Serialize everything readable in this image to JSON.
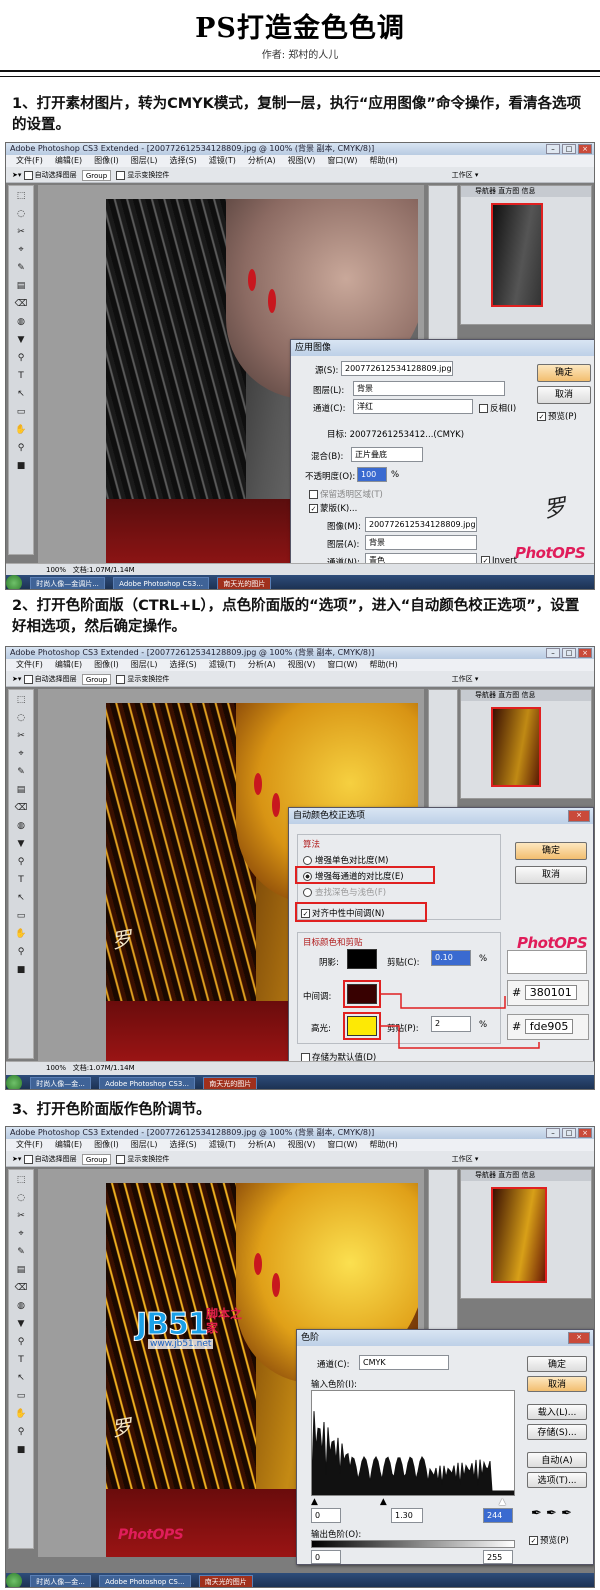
{
  "doc": {
    "title": "PS打造金色色调",
    "author": "作者: 郑村的人儿"
  },
  "steps": [
    {
      "text": "1、打开素材图片，转为CMYK模式，复制一层，执行“应用图像”命令操作，看清各选项的设置。"
    },
    {
      "text": "2、打开色阶面版（CTRL+L），点色阶面版的“选项”，进入“自动颜色校正选项”，设置好相选项，然后确定操作。"
    },
    {
      "text": "3、打开色阶面版作色阶调节。"
    }
  ],
  "app": {
    "window_title": "Adobe Photoshop CS3 Extended - [2007726125341288​09.jpg @ 100% (背景 副本, CMYK/8)]",
    "menus": [
      "文件(F)",
      "编辑(E)",
      "图像(I)",
      "图层(L)",
      "选择(S)",
      "滤镜(T)",
      "分析(A)",
      "视图(V)",
      "窗口(W)",
      "帮助(H)"
    ],
    "options": {
      "auto_select": "自动选择图层",
      "group": "Group",
      "show_transform": "显示变换控件",
      "workspace": "工作区 ▾"
    },
    "status": {
      "zoom": "100%",
      "doc": "文档:1.07M/1.14M"
    },
    "panel_tabs": [
      "导航器",
      "直方图",
      "信息"
    ],
    "tasks": [
      "时尚人像—金...",
      " Adobe Photoshop CS3...",
      "南天光的图片"
    ],
    "task3_step3": "Adobe Photoshop CS...",
    "task1_step1": "时尚人像—金调片..."
  },
  "apply_image": {
    "title": "应用图像",
    "source_label": "源(S):",
    "source_value": "2007726125341288​09.jpg",
    "layer_label": "图层(L):",
    "layer_value": "背景",
    "channel_label": "通道(C):",
    "channel_value": "洋红",
    "invert_label": "反相(I)",
    "target_label": "目标:",
    "target_value": "20077261253412...(CMYK)",
    "blend_label": "混合(B):",
    "blend_value": "正片叠底",
    "opacity_label": "不透明度(O):",
    "opacity_value": "100",
    "opacity_unit": "%",
    "preserve_label": "保留透明区域(T)",
    "mask_label": "蒙版(K)...",
    "image_label": "图像(M):",
    "image_value": "2007726125341288​09.jpg",
    "mlayer_label": "图层(A):",
    "mlayer_value": "背景",
    "mchannel_label": "通道(N):",
    "mchannel_value": "青色",
    "minvert_label": "Invert",
    "ok": "确定",
    "cancel": "取消",
    "preview": "预览(P)"
  },
  "auto_color": {
    "title": "自动颜色校正选项",
    "algo_label": "算法",
    "opt1": "增强单色对比度(M)",
    "opt2": "增强每通道的对比度(E)",
    "opt3": "查找深色与浅色(F)",
    "snap_label": "对齐中性中间调(N)",
    "target_group": "目标颜色和剪贴",
    "shadow_label": "阴影:",
    "clip1_label": "剪贴(C):",
    "clip1_value": "0.10",
    "pct": "%",
    "mid_label": "中间调:",
    "high_label": "高光:",
    "clip2_label": "剪贴(P):",
    "clip2_value": "2",
    "save_default": "存储为默认值(D)",
    "ok": "确定",
    "cancel": "取消",
    "hash": "#",
    "mid_hex": "380101",
    "high_hex": "fde905",
    "colors": {
      "shadow": "#000000",
      "mid": "#380101",
      "high": "#fde905"
    }
  },
  "levels": {
    "title": "色阶",
    "channel_label": "通道(C):",
    "channel_value": "CMYK",
    "input_label": "输入色阶(I):",
    "in_black": "0",
    "in_gamma": "1.30",
    "in_white": "244",
    "output_label": "输出色阶(O):",
    "out_black": "0",
    "out_white": "255",
    "ok": "确定",
    "cancel": "取消",
    "load": "载入(L)...",
    "save": "存储(S)...",
    "auto": "自动(A)",
    "options": "选项(T)...",
    "preview": "预览(P)"
  },
  "watermarks": {
    "photops": "PhotOPS",
    "jb51": "JB51",
    "jb51_cn": "脚本之家",
    "jb51_url": "www.jb51.net"
  }
}
